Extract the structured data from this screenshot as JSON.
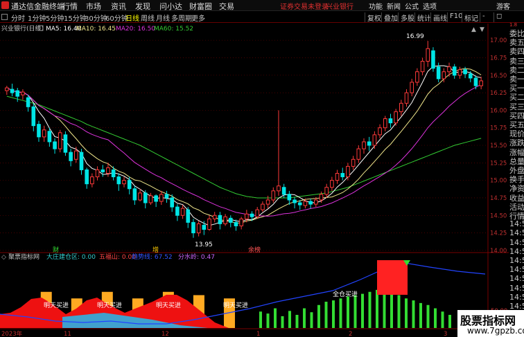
{
  "app": {
    "title": "通达信金融终端",
    "menus": [
      "行情",
      "市场",
      "资讯",
      "发现",
      "问小达",
      "财富圈",
      "交易"
    ],
    "warning": "证券交易未登录",
    "stock_link": "兴业银行",
    "right_menus": [
      "功能",
      "新闻",
      "公式",
      "选项",
      "游客"
    ]
  },
  "toolbar": {
    "periods": [
      "分时",
      "1分钟",
      "5分钟",
      "15分钟",
      "30分钟",
      "60分钟",
      "日线",
      "周线",
      "月线",
      "多周期",
      "更多"
    ],
    "active_period": "日线",
    "right_buttons": [
      "复权",
      "叠加",
      "多股",
      "统计",
      "画线",
      "F10",
      "标记",
      "-",
      "◻"
    ]
  },
  "chart_header": {
    "name": "兴业银行(日线)",
    "ma5": "MA5: 16.40",
    "ma10": "MA10: 16.45",
    "ma20": "MA20: 16.50",
    "ma60": "MA60: 15.52"
  },
  "colors": {
    "up": "#ff3a3a",
    "down": "#00e5e5",
    "ma5": "#ffffff",
    "ma10": "#f0e68c",
    "ma20": "#dd33dd",
    "ma60": "#33cc33",
    "bg": "#000000",
    "grid": "#7a0000"
  },
  "annotations": {
    "high": "16.99",
    "low": "13.95",
    "tag1": "财",
    "tag2": "增",
    "tag3": "余榜"
  },
  "indicator": {
    "name": "聚票指标网",
    "l1": "大庄建仓区: 0.00",
    "l2": "五福山: 0.00",
    "l3": "趋势线: 67.52",
    "l4": "分水岭: 0.47",
    "signals": [
      "明天买进",
      "明天买进",
      "明天买进",
      "明天买进"
    ],
    "full_buy": "全仓买进",
    "level": "50.00"
  },
  "xaxis": [
    "2023年",
    "11",
    "12",
    "1",
    "2",
    "3"
  ],
  "right_panel": [
    "委比",
    "卖五",
    "卖四",
    "卖三",
    "卖二",
    "卖一",
    "买一",
    "买二",
    "买三",
    "买四",
    "买五",
    "现价",
    "涨跌",
    "涨幅",
    "总量",
    "外盘",
    "换手",
    "净资",
    "收益",
    "活动",
    "行情",
    "14:5",
    "14:5",
    "14:5",
    "14:5",
    "14:5",
    "14:5",
    "14:5",
    "14:5",
    "14:5",
    "14:5",
    "14:5"
  ],
  "right_scale": "1.8",
  "watermark": {
    "title": "股票指标网",
    "url": "www.7gpzb.com"
  },
  "chart_data": {
    "type": "candlestick",
    "ylim": [
      13.9,
      17.1
    ],
    "yticks": [
      14.0,
      14.25,
      14.5,
      14.75,
      15.0,
      15.25,
      15.5,
      15.75,
      16.0,
      16.25,
      16.5,
      16.75,
      17.0
    ],
    "candles": [
      [
        16.28,
        16.32,
        16.22,
        16.35
      ],
      [
        16.3,
        16.25,
        16.2,
        16.38
      ],
      [
        16.28,
        16.2,
        16.12,
        16.32
      ],
      [
        16.22,
        16.26,
        16.15,
        16.3
      ],
      [
        16.18,
        16.05,
        15.98,
        16.22
      ],
      [
        16.05,
        15.78,
        15.7,
        16.1
      ],
      [
        15.8,
        15.62,
        15.55,
        15.85
      ],
      [
        15.62,
        15.72,
        15.55,
        15.78
      ],
      [
        15.7,
        15.55,
        15.48,
        15.75
      ],
      [
        15.55,
        15.45,
        15.38,
        15.6
      ],
      [
        15.45,
        15.68,
        15.4,
        15.72
      ],
      [
        15.65,
        15.4,
        15.35,
        15.7
      ],
      [
        15.4,
        15.28,
        15.2,
        15.45
      ],
      [
        15.3,
        15.42,
        15.25,
        15.48
      ],
      [
        15.4,
        15.15,
        15.08,
        15.45
      ],
      [
        15.15,
        14.95,
        14.88,
        15.18
      ],
      [
        14.95,
        15.05,
        14.9,
        15.1
      ],
      [
        15.05,
        15.15,
        15.0,
        15.2
      ],
      [
        15.15,
        15.12,
        15.05,
        15.22
      ],
      [
        15.1,
        15.18,
        15.05,
        15.25
      ],
      [
        15.15,
        15.05,
        15.0,
        15.2
      ],
      [
        15.05,
        14.95,
        14.85,
        15.1
      ],
      [
        14.95,
        15.0,
        14.9,
        15.05
      ],
      [
        15.0,
        14.88,
        14.8,
        15.05
      ],
      [
        14.88,
        14.72,
        14.65,
        14.92
      ],
      [
        14.72,
        14.82,
        14.7,
        14.88
      ],
      [
        14.82,
        14.68,
        14.6,
        14.86
      ],
      [
        14.68,
        14.78,
        14.65,
        14.82
      ],
      [
        14.78,
        14.7,
        14.62,
        14.8
      ],
      [
        14.7,
        14.8,
        14.65,
        14.85
      ],
      [
        14.8,
        14.75,
        14.68,
        14.85
      ],
      [
        14.75,
        14.62,
        14.55,
        14.8
      ],
      [
        14.62,
        14.5,
        14.42,
        14.66
      ],
      [
        14.5,
        14.6,
        14.45,
        14.65
      ],
      [
        14.58,
        14.4,
        14.32,
        14.62
      ],
      [
        14.4,
        14.25,
        14.18,
        14.45
      ],
      [
        14.25,
        14.38,
        14.2,
        14.42
      ],
      [
        14.36,
        14.3,
        14.22,
        14.42
      ],
      [
        14.3,
        14.45,
        14.28,
        14.5
      ],
      [
        14.45,
        14.5,
        14.4,
        14.55
      ],
      [
        14.5,
        14.38,
        14.3,
        14.55
      ],
      [
        14.38,
        14.48,
        14.35,
        14.52
      ],
      [
        14.46,
        14.4,
        14.33,
        14.5
      ],
      [
        14.4,
        14.35,
        14.28,
        14.44
      ],
      [
        14.35,
        14.45,
        14.3,
        14.48
      ],
      [
        14.45,
        14.52,
        14.4,
        14.58
      ],
      [
        14.52,
        14.48,
        14.42,
        14.56
      ],
      [
        14.48,
        14.58,
        14.45,
        14.62
      ],
      [
        14.58,
        14.66,
        14.55,
        14.7
      ],
      [
        14.66,
        14.72,
        14.6,
        14.78
      ],
      [
        14.72,
        14.85,
        14.68,
        14.9
      ],
      [
        14.85,
        14.92,
        14.78,
        16.0
      ],
      [
        14.9,
        14.8,
        14.75,
        14.95
      ],
      [
        14.8,
        14.72,
        14.65,
        14.85
      ],
      [
        14.72,
        14.68,
        14.6,
        14.76
      ],
      [
        14.68,
        14.65,
        14.58,
        14.72
      ],
      [
        14.64,
        14.7,
        14.6,
        14.74
      ],
      [
        14.7,
        14.66,
        14.6,
        14.74
      ],
      [
        14.66,
        14.72,
        14.62,
        14.76
      ],
      [
        14.72,
        14.8,
        14.68,
        14.84
      ],
      [
        14.8,
        14.9,
        14.75,
        14.95
      ],
      [
        14.9,
        15.0,
        14.85,
        15.05
      ],
      [
        15.0,
        15.1,
        14.95,
        15.15
      ],
      [
        15.1,
        15.05,
        15.0,
        15.18
      ],
      [
        15.05,
        15.2,
        15.0,
        15.25
      ],
      [
        15.2,
        15.3,
        15.15,
        15.35
      ],
      [
        15.3,
        15.45,
        15.25,
        15.5
      ],
      [
        15.45,
        15.55,
        15.38,
        15.6
      ],
      [
        15.55,
        15.5,
        15.42,
        15.62
      ],
      [
        15.5,
        15.65,
        15.45,
        15.7
      ],
      [
        15.65,
        15.75,
        15.6,
        15.8
      ],
      [
        15.75,
        15.88,
        15.7,
        15.92
      ],
      [
        15.88,
        15.82,
        15.75,
        15.95
      ],
      [
        15.82,
        15.98,
        15.78,
        16.02
      ],
      [
        15.98,
        16.1,
        15.92,
        16.15
      ],
      [
        16.1,
        16.25,
        16.05,
        16.3
      ],
      [
        16.25,
        16.4,
        16.2,
        16.45
      ],
      [
        16.4,
        16.55,
        16.35,
        16.6
      ],
      [
        16.55,
        16.7,
        16.5,
        16.75
      ],
      [
        16.7,
        16.88,
        16.62,
        16.99
      ],
      [
        16.85,
        16.6,
        16.55,
        16.9
      ],
      [
        16.62,
        16.45,
        16.4,
        16.68
      ],
      [
        16.45,
        16.55,
        16.4,
        16.6
      ],
      [
        16.55,
        16.62,
        16.48,
        16.68
      ],
      [
        16.62,
        16.5,
        16.45,
        16.66
      ],
      [
        16.5,
        16.58,
        16.45,
        16.62
      ],
      [
        16.58,
        16.52,
        16.46,
        16.62
      ],
      [
        16.52,
        16.46,
        16.4,
        16.56
      ],
      [
        16.46,
        16.35,
        16.3,
        16.5
      ],
      [
        16.35,
        16.42,
        16.3,
        16.48
      ]
    ],
    "ma60": [
      16.2,
      16.18,
      16.16,
      16.14,
      16.12,
      16.1,
      16.08,
      16.05,
      16.02,
      15.99,
      15.96,
      15.93,
      15.9,
      15.87,
      15.84,
      15.8,
      15.77,
      15.74,
      15.71,
      15.68,
      15.65,
      15.62,
      15.59,
      15.56,
      15.53,
      15.5,
      15.46,
      15.42,
      15.38,
      15.34,
      15.3,
      15.26,
      15.22,
      15.18,
      15.14,
      15.1,
      15.06,
      15.02,
      14.98,
      14.94,
      14.9,
      14.87,
      14.84,
      14.81,
      14.79,
      14.77,
      14.76,
      14.75,
      14.75,
      14.75,
      14.75,
      14.75,
      14.75,
      14.75,
      14.76,
      14.77,
      14.78,
      14.79,
      14.8,
      14.81,
      14.82,
      14.84,
      14.86,
      14.88,
      14.9,
      14.93,
      14.96,
      14.99,
      15.02,
      15.05,
      15.08,
      15.11,
      15.14,
      15.17,
      15.2,
      15.23,
      15.26,
      15.29,
      15.32,
      15.35,
      15.38,
      15.41,
      15.44,
      15.47,
      15.5,
      15.52,
      15.54,
      15.56,
      15.58,
      15.6
    ],
    "bars": [
      {
        "x": 0.08,
        "h": 0.55
      },
      {
        "x": 0.14,
        "h": 0.45
      },
      {
        "x": 0.2,
        "h": 0.55
      },
      {
        "x": 0.26,
        "h": 0.45
      },
      {
        "x": 0.32,
        "h": 0.55
      },
      {
        "x": 0.38,
        "h": 0.5
      },
      {
        "x": 0.44,
        "h": 0.45
      }
    ],
    "green_bars": [
      0.25,
      0.22,
      0.3,
      0.18,
      0.26,
      0.2,
      0.3,
      0.24,
      0.35,
      0.4,
      0.42,
      0.45,
      0.48,
      0.5,
      0.52,
      0.55,
      0.58,
      0.62,
      0.55,
      0.5,
      0.45,
      0.42,
      0.38,
      0.35,
      0.3,
      0.25,
      0.2
    ]
  }
}
